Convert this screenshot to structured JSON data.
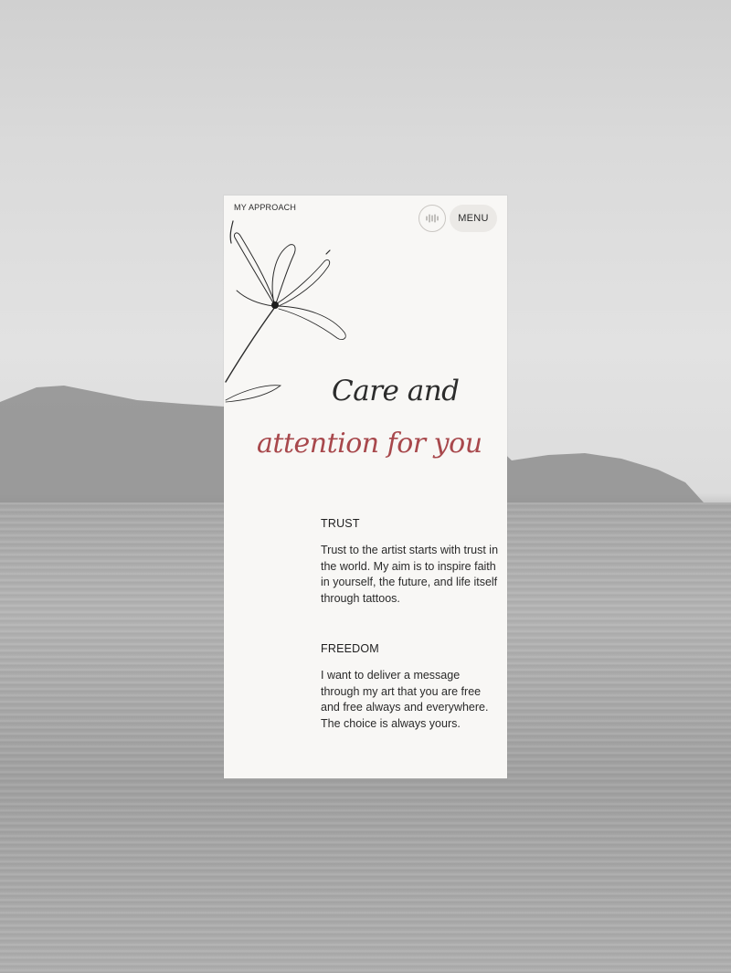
{
  "header": {
    "section_label": "MY APPROACH",
    "menu_label": "MENU",
    "sound_icon": "sound-wave-icon"
  },
  "hero": {
    "line1": "Care and",
    "line2": "attention for you"
  },
  "sections": [
    {
      "title": "TRUST",
      "body": "Trust to the artist starts with trust in the world. My aim is to inspire faith in yourself, the future, and life itself through tattoos."
    },
    {
      "title": "FREEDOM",
      "body": "I want to deliver a message through my art that you are free and free always and everywhere. The choice is always yours."
    }
  ],
  "colors": {
    "accent": "#a8484c",
    "card": "#f8f7f5",
    "text": "#2a2a2a"
  }
}
